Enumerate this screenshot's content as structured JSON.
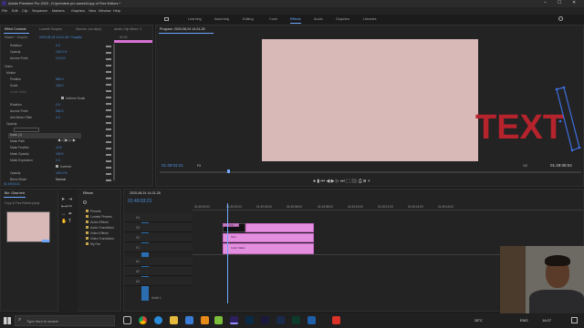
{
  "app": {
    "title": "Adobe Premiere Pro 2020 - D:\\premiere pro saves\\Copy of Free Editors *",
    "window_controls": [
      "–",
      "☐",
      "✕"
    ]
  },
  "menu": [
    "File",
    "Edit",
    "Clip",
    "Sequence",
    "Markers",
    "Graphics",
    "View",
    "Window",
    "Help"
  ],
  "workspaces": [
    "Learning",
    "Assembly",
    "Editing",
    "Color",
    "Effects",
    "Audio",
    "Graphics",
    "Libraries"
  ],
  "workspace_active": "Effects",
  "effect_controls": {
    "tabs": [
      "Effect Controls",
      "Lumetri Scopes",
      "Source: (no clips)",
      "Audio Clip Mixer: 2"
    ],
    "source_label": "Master * Graphic",
    "clip_label": "2020-08-24 14-01-28 * Graphic",
    "time_label": "00:00",
    "rows": [
      {
        "name": "Rotation",
        "value": "0.0"
      },
      {
        "name": "Opacity",
        "value": "100.0 %"
      },
      {
        "name": "Anchor Point",
        "value": "0.0   0.0"
      },
      {
        "name": "Video",
        "value": ""
      },
      {
        "name": "Motion",
        "value": ""
      },
      {
        "name": "Position",
        "value": "960.0"
      },
      {
        "name": "Scale",
        "value": "100.0"
      },
      {
        "name": "Scale Width",
        "value": ""
      },
      {
        "name": "Uniform Scale",
        "value": ""
      },
      {
        "name": "Rotation",
        "value": "0.0"
      },
      {
        "name": "Anchor Point",
        "value": "960.0"
      },
      {
        "name": "Anti-flicker Filter",
        "value": "0.0"
      },
      {
        "name": "Opacity",
        "value": ""
      },
      {
        "name": "Mask (1)",
        "value": ""
      },
      {
        "name": "Mask Path",
        "value": ""
      },
      {
        "name": "Mask Feather",
        "value": "10.0"
      },
      {
        "name": "Mask Opacity",
        "value": "100.0"
      },
      {
        "name": "Mask Expansion",
        "value": "0.0"
      },
      {
        "name": "Inverted",
        "value": ""
      },
      {
        "name": "Opacity",
        "value": "100.0 %"
      },
      {
        "name": "Blend Mode",
        "value": "Normal"
      }
    ],
    "footer_time": "01:49:03:21"
  },
  "program": {
    "title": "Program: 2020-08-24 14-01-28",
    "overlay_text": "TEXT",
    "timecode": "01:49:03:21",
    "fit": "Fit",
    "quality": "1/2",
    "duration": "01:49:08:04",
    "colors": {
      "frame": "#d9b8b8",
      "text": "#b5232c",
      "mask": "#3d6fe0"
    }
  },
  "project": {
    "tabs": [
      "Bin: Glow text",
      "Effects"
    ],
    "filename": "Copy of Free Editors.prproj",
    "items": [
      "Presets",
      "Lumetri Presets",
      "Audio Effects",
      "Audio Transitions",
      "Video Effects",
      "Video Transitions",
      "My Fav"
    ]
  },
  "timeline": {
    "sequence_tab": "2020-08-24 14-01-28",
    "timecode": "01:49:03:21",
    "ruler": [
      "01:49:00:00",
      "01:49:02:00",
      "01:49:04:00",
      "01:49:06:00",
      "01:49:08:00",
      "01:49:10:00",
      "01:49:12:00",
      "01:49:14:00",
      "01:49:16:00"
    ],
    "tracks": [
      "V4",
      "V3",
      "V2",
      "V1",
      "A1",
      "A2",
      "A3",
      "Audio 1"
    ],
    "clips": [
      "Text",
      "Text",
      "Color Matte"
    ]
  },
  "taskbar": {
    "search_placeholder": "Type here to search",
    "weather": "28°C",
    "lang": "ENG",
    "time": "14:07"
  }
}
